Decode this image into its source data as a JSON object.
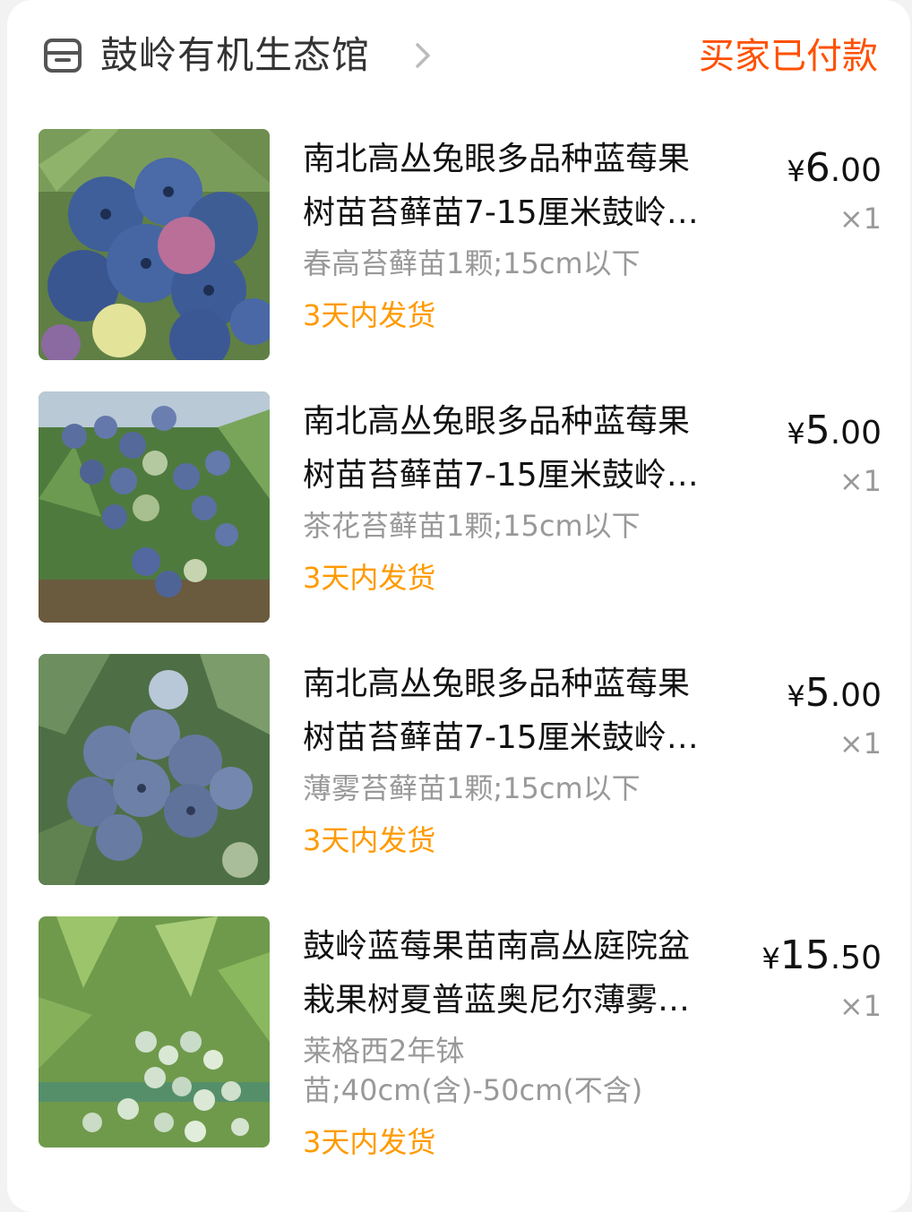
{
  "header": {
    "store_name": "鼓岭有机生态馆",
    "status": "买家已付款",
    "icons": {
      "store": "store-icon",
      "chevron": "chevron-right-icon"
    }
  },
  "colors": {
    "accent": "#ff5000",
    "ship": "#ff9a00",
    "muted": "#999999"
  },
  "items": [
    {
      "title_line1": "南北高丛兔眼多品种蓝莓果",
      "title_line2": "树苗苔藓苗7-15厘米鼓岭…",
      "sku": "春高苔藓苗1颗;15cm以下",
      "ship": "3天内发货",
      "price_symbol": "¥",
      "price_int": "6",
      "price_dec": ".00",
      "qty": "×1"
    },
    {
      "title_line1": "南北高丛兔眼多品种蓝莓果",
      "title_line2": "树苗苔藓苗7-15厘米鼓岭…",
      "sku": "茶花苔藓苗1颗;15cm以下",
      "ship": "3天内发货",
      "price_symbol": "¥",
      "price_int": "5",
      "price_dec": ".00",
      "qty": "×1"
    },
    {
      "title_line1": "南北高丛兔眼多品种蓝莓果",
      "title_line2": "树苗苔藓苗7-15厘米鼓岭…",
      "sku": "薄雾苔藓苗1颗;15cm以下",
      "ship": "3天内发货",
      "price_symbol": "¥",
      "price_int": "5",
      "price_dec": ".00",
      "qty": "×1"
    },
    {
      "title_line1": "鼓岭蓝莓果苗南高丛庭院盆",
      "title_line2": "栽果树夏普蓝奥尼尔薄雾…",
      "sku": "莱格西2年钵苗;40cm(含)-50cm(不含)",
      "ship": "3天内发货",
      "price_symbol": "¥",
      "price_int": "15",
      "price_dec": ".50",
      "qty": "×1"
    }
  ]
}
